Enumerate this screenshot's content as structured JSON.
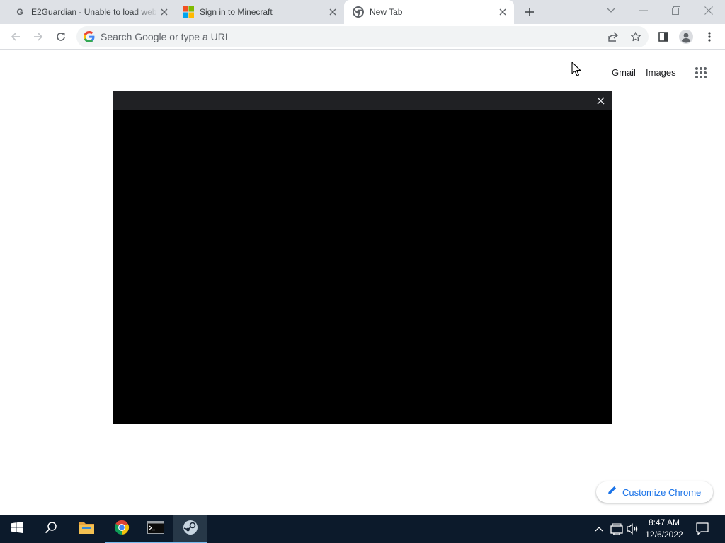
{
  "browser": {
    "tabs": [
      {
        "title": "E2Guardian - Unable to load web",
        "favicon": "google-g-icon",
        "active": false
      },
      {
        "title": "Sign in to Minecraft",
        "favicon": "microsoft-icon",
        "active": false
      },
      {
        "title": "New Tab",
        "favicon": "chrome-icon",
        "active": true
      }
    ],
    "omnibox": {
      "placeholder": "Search Google or type a URL",
      "value": ""
    }
  },
  "newtab": {
    "gmail_label": "Gmail",
    "images_label": "Images",
    "customize_label": "Customize Chrome"
  },
  "taskbar": {
    "apps": [
      "start-icon",
      "search-icon",
      "file-explorer-icon",
      "chrome-icon",
      "terminal-icon",
      "steam-icon"
    ],
    "clock": {
      "time": "8:47 AM",
      "date": "12/6/2022"
    }
  },
  "colors": {
    "tabstrip_bg": "#dee1e6",
    "link_blue": "#1a73e8",
    "taskbar_bg": "#0c1a2b",
    "overlay_bg": "#000000"
  }
}
